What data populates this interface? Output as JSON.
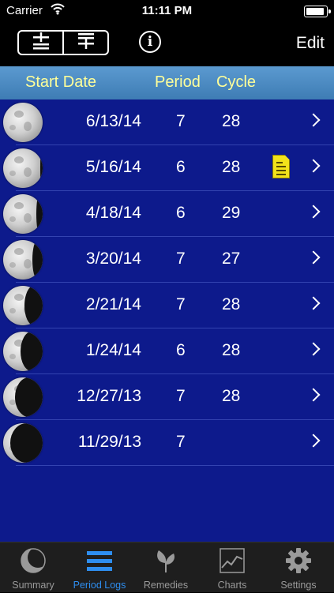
{
  "status_bar": {
    "carrier": "Carrier",
    "time": "11:11 PM"
  },
  "toolbar": {
    "add_subtract_icon": "plus-minus-icon",
    "add_list_icon": "list-add-icon",
    "info_label": "i",
    "edit_label": "Edit"
  },
  "columns": {
    "start_date": "Start Date",
    "period": "Period",
    "cycle": "Cycle"
  },
  "rows": [
    {
      "date": "6/13/14",
      "period": "7",
      "cycle": "28",
      "note": false,
      "phase_shadow": 0.0
    },
    {
      "date": "5/16/14",
      "period": "6",
      "cycle": "28",
      "note": true,
      "phase_shadow": 0.05
    },
    {
      "date": "4/18/14",
      "period": "6",
      "cycle": "29",
      "note": false,
      "phase_shadow": 0.15
    },
    {
      "date": "3/20/14",
      "period": "7",
      "cycle": "27",
      "note": false,
      "phase_shadow": 0.25
    },
    {
      "date": "2/21/14",
      "period": "7",
      "cycle": "28",
      "note": false,
      "phase_shadow": 0.45
    },
    {
      "date": "1/24/14",
      "period": "6",
      "cycle": "28",
      "note": false,
      "phase_shadow": 0.55
    },
    {
      "date": "12/27/13",
      "period": "7",
      "cycle": "28",
      "note": false,
      "phase_shadow": 0.7
    },
    {
      "date": "11/29/13",
      "period": "7",
      "cycle": "",
      "note": false,
      "phase_shadow": 0.82
    }
  ],
  "tabs": [
    {
      "label": "Summary",
      "icon": "moon-icon",
      "active": false
    },
    {
      "label": "Period Logs",
      "icon": "list-icon",
      "active": true
    },
    {
      "label": "Remedies",
      "icon": "leaf-icon",
      "active": false
    },
    {
      "label": "Charts",
      "icon": "chart-icon",
      "active": false
    },
    {
      "label": "Settings",
      "icon": "gear-icon",
      "active": false
    }
  ],
  "colors": {
    "list_background": "#0d1a8c",
    "header_text": "#ffff99",
    "active_tab": "#2e8ef0",
    "note": "#f2e21a"
  }
}
